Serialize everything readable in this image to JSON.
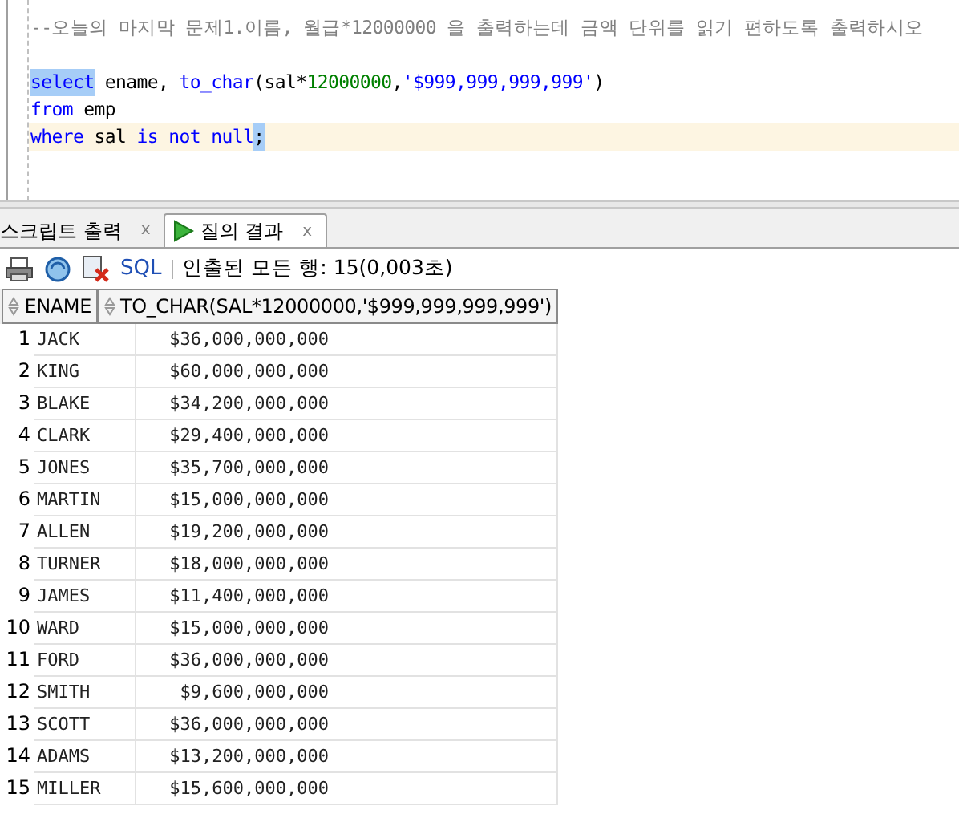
{
  "editor": {
    "lines": [
      {
        "current": false,
        "tokens": [
          {
            "kind": "comment",
            "text": "--오늘의 마지막 문제1.이름, 월급*12000000 을 출력하는데 금액 단위를 읽기 편하도록 출력하시오",
            "selected": false
          }
        ]
      },
      {
        "current": false
      },
      {
        "current": false,
        "tokens": [
          {
            "kind": "keyword",
            "text": "select",
            "selected": true
          },
          {
            "kind": "plain",
            "text": " ename, ",
            "selected": false
          },
          {
            "kind": "keyword",
            "text": "to_char",
            "selected": false
          },
          {
            "kind": "plain",
            "text": "(sal*",
            "selected": false
          },
          {
            "kind": "number",
            "text": "12000000",
            "selected": false
          },
          {
            "kind": "plain",
            "text": ",",
            "selected": false
          },
          {
            "kind": "string",
            "text": "'$999,999,999,999'",
            "selected": false
          },
          {
            "kind": "plain",
            "text": ")",
            "selected": false
          }
        ]
      },
      {
        "current": false,
        "tokens": [
          {
            "kind": "keyword",
            "text": "from",
            "selected": false
          },
          {
            "kind": "plain",
            "text": " emp",
            "selected": false
          }
        ]
      },
      {
        "current": true,
        "tokens": [
          {
            "kind": "keyword",
            "text": "where",
            "selected": false
          },
          {
            "kind": "plain",
            "text": " sal ",
            "selected": false
          },
          {
            "kind": "keyword",
            "text": "is not null",
            "selected": false
          },
          {
            "kind": "plain",
            "text": ";",
            "selected": true
          }
        ]
      }
    ]
  },
  "tabs": [
    {
      "label": "스크립트 출력",
      "close": "x",
      "selected": false,
      "icon": false
    },
    {
      "label": "질의 결과",
      "close": "x",
      "selected": true,
      "icon": true
    }
  ],
  "toolbar": {
    "sql": "SQL",
    "status": "인출된 모든 행: 15(0,003초)"
  },
  "table": {
    "columns": [
      "",
      "ENAME",
      "TO_CHAR(SAL*12000000,'$999,999,999,999')"
    ],
    "rows": [
      [
        "1",
        "JACK",
        "$36,000,000,000"
      ],
      [
        "2",
        "KING",
        "$60,000,000,000"
      ],
      [
        "3",
        "BLAKE",
        "$34,200,000,000"
      ],
      [
        "4",
        "CLARK",
        "$29,400,000,000"
      ],
      [
        "5",
        "JONES",
        "$35,700,000,000"
      ],
      [
        "6",
        "MARTIN",
        "$15,000,000,000"
      ],
      [
        "7",
        "ALLEN",
        "$19,200,000,000"
      ],
      [
        "8",
        "TURNER",
        "$18,000,000,000"
      ],
      [
        "9",
        "JAMES",
        "$11,400,000,000"
      ],
      [
        "10",
        "WARD",
        "$15,000,000,000"
      ],
      [
        "11",
        "FORD",
        "$36,000,000,000"
      ],
      [
        "12",
        "SMITH",
        "$9,600,000,000"
      ],
      [
        "13",
        "SCOTT",
        "$36,000,000,000"
      ],
      [
        "14",
        "ADAMS",
        "$13,200,000,000"
      ],
      [
        "15",
        "MILLER",
        "$15,600,000,000"
      ]
    ]
  }
}
